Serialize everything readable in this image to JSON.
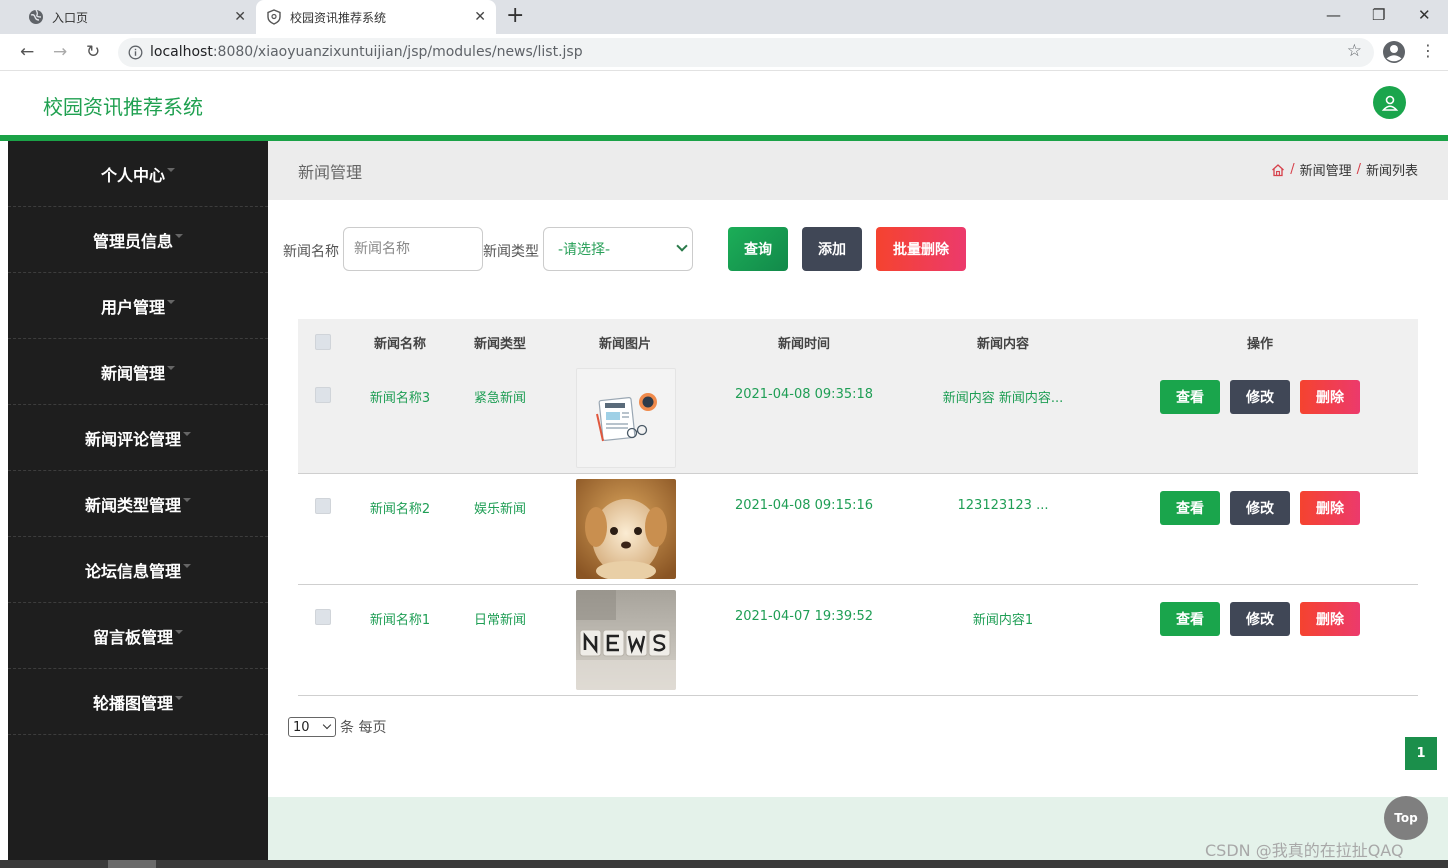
{
  "browser": {
    "tabs": [
      {
        "title": "入口页",
        "active": false
      },
      {
        "title": "校园资讯推荐系统",
        "active": true
      }
    ],
    "new_tab": "+",
    "url_host": "localhost",
    "url_path": ":8080/xiaoyuanzixuntuijian/jsp/modules/news/list.jsp",
    "window_controls": {
      "minimize": "—",
      "restore": "❐",
      "close": "✕"
    }
  },
  "app": {
    "title": "校园资讯推荐系统",
    "accent_color": "#1ba247"
  },
  "sidebar": {
    "items": [
      {
        "label": "个人中心"
      },
      {
        "label": "管理员信息"
      },
      {
        "label": "用户管理"
      },
      {
        "label": "新闻管理"
      },
      {
        "label": "新闻评论管理"
      },
      {
        "label": "新闻类型管理"
      },
      {
        "label": "论坛信息管理"
      },
      {
        "label": "留言板管理"
      },
      {
        "label": "轮播图管理"
      }
    ]
  },
  "page": {
    "title": "新闻管理",
    "breadcrumb": [
      "新闻管理",
      "新闻列表"
    ]
  },
  "search": {
    "name_label": "新闻名称",
    "name_placeholder": "新闻名称",
    "type_label": "新闻类型",
    "type_selected": "-请选择-",
    "query_label": "查询",
    "add_label": "添加",
    "bulk_delete_label": "批量删除"
  },
  "table": {
    "headers": [
      "新闻名称",
      "新闻类型",
      "新闻图片",
      "新闻时间",
      "新闻内容",
      "操作"
    ],
    "rows": [
      {
        "name": "新闻名称3",
        "type": "紧急新闻",
        "image": "news-illustration",
        "time": "2021-04-08 09:35:18",
        "content": "新闻内容 新闻内容..."
      },
      {
        "name": "新闻名称2",
        "type": "娱乐新闻",
        "image": "puppy-photo",
        "time": "2021-04-08 09:15:16",
        "content": "123123123 ..."
      },
      {
        "name": "新闻名称1",
        "type": "日常新闻",
        "image": "news-dice-photo",
        "time": "2021-04-07 19:39:52",
        "content": "新闻内容1"
      }
    ],
    "actions": {
      "view": "查看",
      "edit": "修改",
      "delete": "删除"
    }
  },
  "pagination": {
    "page_size": "10",
    "page_size_suffix": "条 每页",
    "current_page": "1"
  },
  "top_button": "Top",
  "watermark": "CSDN @我真的在拉扯QAQ"
}
